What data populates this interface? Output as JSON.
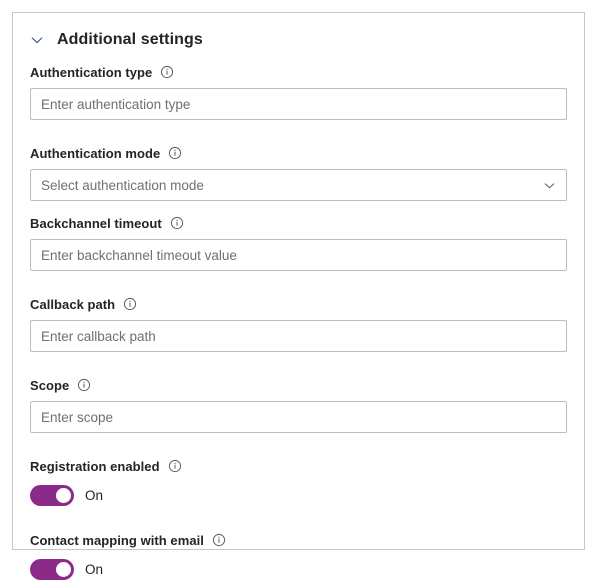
{
  "section": {
    "title": "Additional settings",
    "expanded": true,
    "collapse_icon": "chevron-down-icon"
  },
  "theme": {
    "accent": "#8A2B8A",
    "border": "#bdbdbd",
    "card_border": "#c8c6c4",
    "label_text": "#242424",
    "placeholder_text": "#707070",
    "background": "#ffffff"
  },
  "fields": {
    "authentication_type": {
      "label": "Authentication type",
      "info_icon": "info-icon",
      "placeholder": "Enter authentication type",
      "value": ""
    },
    "authentication_mode": {
      "label": "Authentication mode",
      "info_icon": "info-icon",
      "placeholder": "Select authentication mode",
      "value": "Select authentication mode",
      "chevron_icon": "chevron-down-icon"
    },
    "backchannel_timeout": {
      "label": "Backchannel timeout",
      "info_icon": "info-icon",
      "placeholder": "Enter backchannel timeout value",
      "value": ""
    },
    "callback_path": {
      "label": "Callback path",
      "info_icon": "info-icon",
      "placeholder": "Enter callback path",
      "value": ""
    },
    "scope": {
      "label": "Scope",
      "info_icon": "info-icon",
      "placeholder": "Enter scope",
      "value": ""
    },
    "registration_enabled": {
      "label": "Registration enabled",
      "info_icon": "info-icon",
      "state_label": "On",
      "checked": true
    },
    "contact_mapping_with_email": {
      "label": "Contact mapping with email",
      "info_icon": "info-icon",
      "state_label": "On",
      "checked": true
    }
  }
}
